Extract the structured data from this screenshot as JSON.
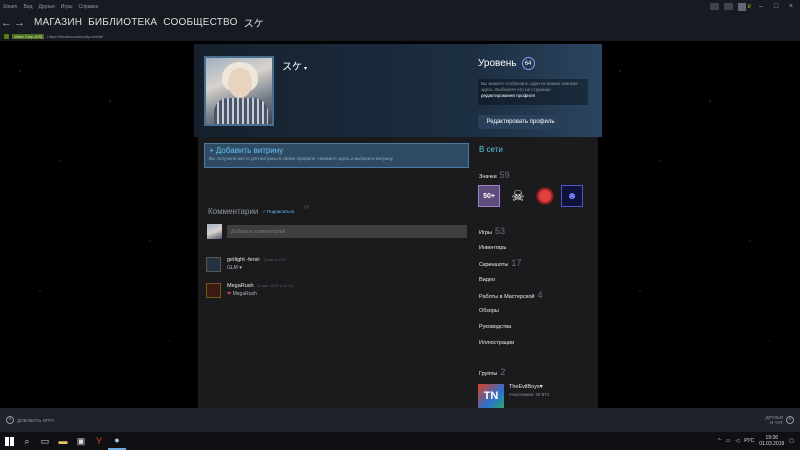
{
  "menubar": {
    "items": [
      "Steam",
      "Вид",
      "Друзья",
      "Игры",
      "Справка"
    ],
    "user_balance": "₽"
  },
  "nav": {
    "tabs": [
      "МАГАЗИН",
      "БИБЛИОТЕКА",
      "СООБЩЕСТВО",
      "スケ"
    ]
  },
  "address": {
    "cert": "Valve Corp [US]",
    "url": "https://steamcommunity.com/id/"
  },
  "profile": {
    "persona_name": "スケ",
    "level_label": "Уровень",
    "level_value": "64",
    "level_hint_text": "Вы можете отобразить один из ваших значков здесь. Выберите его на странице",
    "level_hint_link": "редактирования профиля",
    "edit_profile_label": "Редактировать профиль"
  },
  "showcase": {
    "title": "+ Добавить витрину",
    "description": "Вы получили место для витрины в своем профиле. Нажмите здесь и выберите витрину."
  },
  "comments": {
    "title": "Комментарии",
    "subscribe_label": "Подписаться",
    "help": "(?)",
    "input_placeholder": "Добавить комментарий",
    "items": [
      {
        "author": "getlight -ferst-",
        "time": "5 мая в 5:37",
        "message": "GLM ♥"
      },
      {
        "author": "MegaRush",
        "time": "24 авг. 2018 в 21:04",
        "message": "MegaRush"
      }
    ]
  },
  "sidebar": {
    "status": "В сети",
    "badges_label": "Значки",
    "badges_count": "59",
    "badge_icons": [
      "50+",
      "☠",
      "",
      "☻"
    ],
    "games_label": "Игры",
    "games_count": "53",
    "inventory_label": "Инвентарь",
    "screenshots_label": "Скриншоты",
    "screenshots_count": "17",
    "videos_label": "Видео",
    "workshop_label": "Работы в Мастерской",
    "workshop_count": "4",
    "reviews_label": "Обзоры",
    "guides_label": "Руководства",
    "artwork_label": "Иллюстрации",
    "groups_label": "Группы",
    "groups_count": "2",
    "group_name": "TheEvilBoys♥",
    "group_members": "Участников: 26 871",
    "group_icon_text": "TN"
  },
  "bottombar": {
    "add_game_label": "ДОБАВИТЬ ИГРУ",
    "friends_label_1": "ДРУЗЬЯ",
    "friends_label_2": "И ЧАТ"
  },
  "taskbar": {
    "lang": "РУС",
    "time": "19:36",
    "date": "01.03.2019"
  }
}
